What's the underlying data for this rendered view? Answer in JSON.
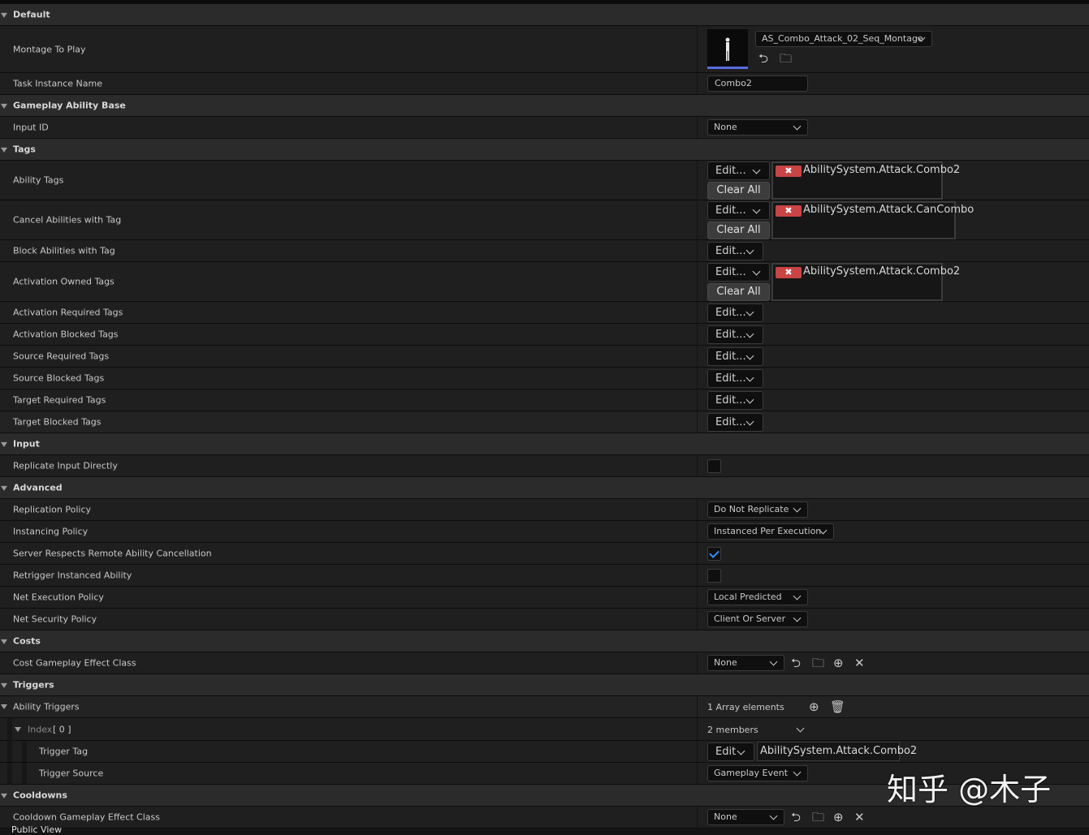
{
  "sections": {
    "default": "Default",
    "gameplay_ability_base": "Gameplay Ability Base",
    "tags": "Tags",
    "input": "Input",
    "advanced": "Advanced",
    "costs": "Costs",
    "triggers": "Triggers",
    "cooldowns": "Cooldowns"
  },
  "props": {
    "montage_to_play": "Montage To Play",
    "task_instance_name": "Task Instance Name",
    "input_id": "Input ID",
    "ability_tags": "Ability Tags",
    "cancel_abilities_with_tag": "Cancel Abilities with Tag",
    "block_abilities_with_tag": "Block Abilities with Tag",
    "activation_owned_tags": "Activation Owned Tags",
    "activation_required_tags": "Activation Required Tags",
    "activation_blocked_tags": "Activation Blocked Tags",
    "source_required_tags": "Source Required Tags",
    "source_blocked_tags": "Source Blocked Tags",
    "target_required_tags": "Target Required Tags",
    "target_blocked_tags": "Target Blocked Tags",
    "replicate_input_directly": "Replicate Input Directly",
    "replication_policy": "Replication Policy",
    "instancing_policy": "Instancing Policy",
    "server_respects_remote_ability_cancellation": "Server Respects Remote Ability Cancellation",
    "retrigger_instanced_ability": "Retrigger Instanced Ability",
    "net_execution_policy": "Net Execution Policy",
    "net_security_policy": "Net Security Policy",
    "cost_gameplay_effect_class": "Cost Gameplay Effect Class",
    "ability_triggers": "Ability Triggers",
    "index_label": "Index",
    "index_value": "[ 0 ]",
    "trigger_tag": "Trigger Tag",
    "trigger_source": "Trigger Source",
    "cooldown_gameplay_effect_class": "Cooldown Gameplay Effect Class"
  },
  "values": {
    "montage_asset": "AS_Combo_Attack_02_Seq_Montage",
    "task_instance_name": "Combo2",
    "input_id": "None",
    "edit_label": "Edit...",
    "edit_short": "Edit",
    "clear_all": "Clear All",
    "ability_tag": "AbilitySystem.Attack.Combo2",
    "cancel_tag": "AbilitySystem.Attack.CanCombo",
    "activation_owned_tag": "AbilitySystem.Attack.Combo2",
    "replicate_input_directly": false,
    "replication_policy": "Do Not Replicate",
    "instancing_policy": "Instanced Per Execution",
    "server_respects_remote_ability_cancellation": true,
    "retrigger_instanced_ability": false,
    "net_execution_policy": "Local Predicted",
    "net_security_policy": "Client Or Server",
    "cost_class": "None",
    "array_elements": "1 Array elements",
    "members": "2 members",
    "trigger_tag": "AbilitySystem.Attack.Combo2",
    "trigger_source": "Gameplay Event",
    "cooldown_class": "None"
  },
  "watermark": "知乎 @木子",
  "footer": "Public View",
  "icons": {
    "use_selected": "arrow-left-icon",
    "browse": "folder-search-icon",
    "add": "plus-circle-icon",
    "clear": "close-icon",
    "delete": "trash-icon"
  }
}
